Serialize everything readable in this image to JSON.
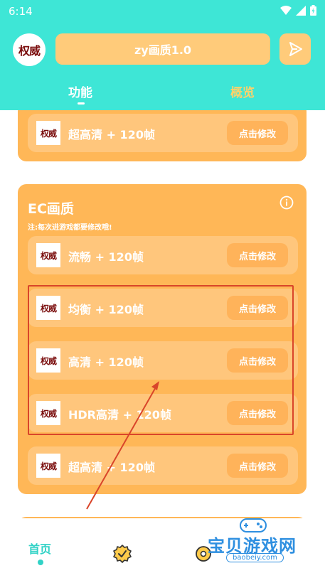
{
  "status_bar": {
    "time": "6:14"
  },
  "header": {
    "logo_text": "权威",
    "title": "zy画质1.0",
    "tabs": [
      {
        "label": "功能",
        "active": true
      },
      {
        "label": "概览",
        "active": false
      }
    ]
  },
  "top_card": {
    "rows": [
      {
        "thumb": "权威",
        "label": "超高清 + 120帧",
        "button": "点击修改"
      }
    ]
  },
  "ec_card": {
    "title": "EC画质",
    "note": "注:每次进游戏都要修改哦!",
    "rows": [
      {
        "thumb": "权威",
        "label": "流畅 + 120帧",
        "button": "点击修改"
      },
      {
        "thumb": "权威",
        "label": "均衡 + 120帧",
        "button": "点击修改"
      },
      {
        "thumb": "权威",
        "label": "高清 + 120帧",
        "button": "点击修改"
      },
      {
        "thumb": "权威",
        "label": "HDR高清 + 120帧",
        "button": "点击修改"
      },
      {
        "thumb": "权威",
        "label": "超高清 + 120帧",
        "button": "点击修改"
      }
    ]
  },
  "bottom_nav": {
    "home_label": "首页"
  },
  "watermark": {
    "text": "宝贝游戏网",
    "url": "baobeiy.com"
  },
  "colors": {
    "header_bg": "#3ee6d6",
    "card_bg": "#ffb757",
    "row_bg": "#ffc67c",
    "highlight": "#d9452a",
    "accent": "#30d2c6"
  }
}
